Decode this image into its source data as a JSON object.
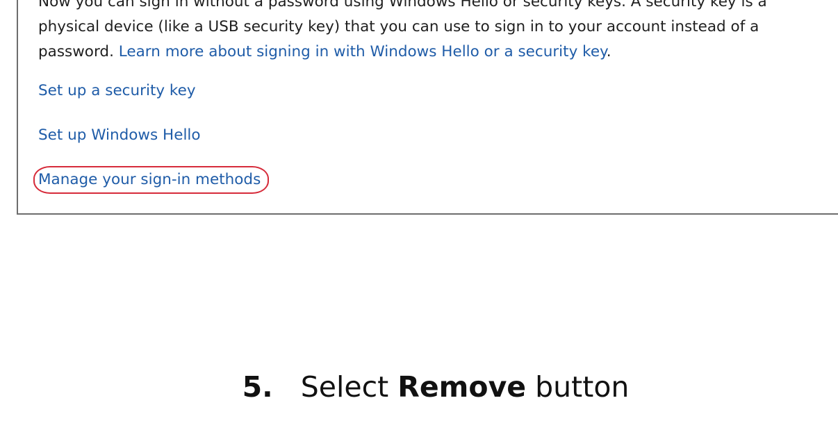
{
  "panel": {
    "intro_text": "Now you can sign in without a password using Windows Hello or security keys. A security key is a physical device (like a USB security key) that you can use to sign in to your account instead of a password.",
    "learn_more_link": "Learn more about signing in with Windows Hello or a security key",
    "learn_more_end": ".",
    "links": [
      {
        "label": "Set up a security key"
      },
      {
        "label": "Set up Windows Hello"
      },
      {
        "label": "Manage your sign-in methods",
        "highlighted": true
      }
    ],
    "highlight_color": "#d62b3a",
    "link_color": "#1f5ca8"
  },
  "step": {
    "number": "5.",
    "prefix": "Select",
    "bold_word": "Remove",
    "suffix": "button"
  }
}
